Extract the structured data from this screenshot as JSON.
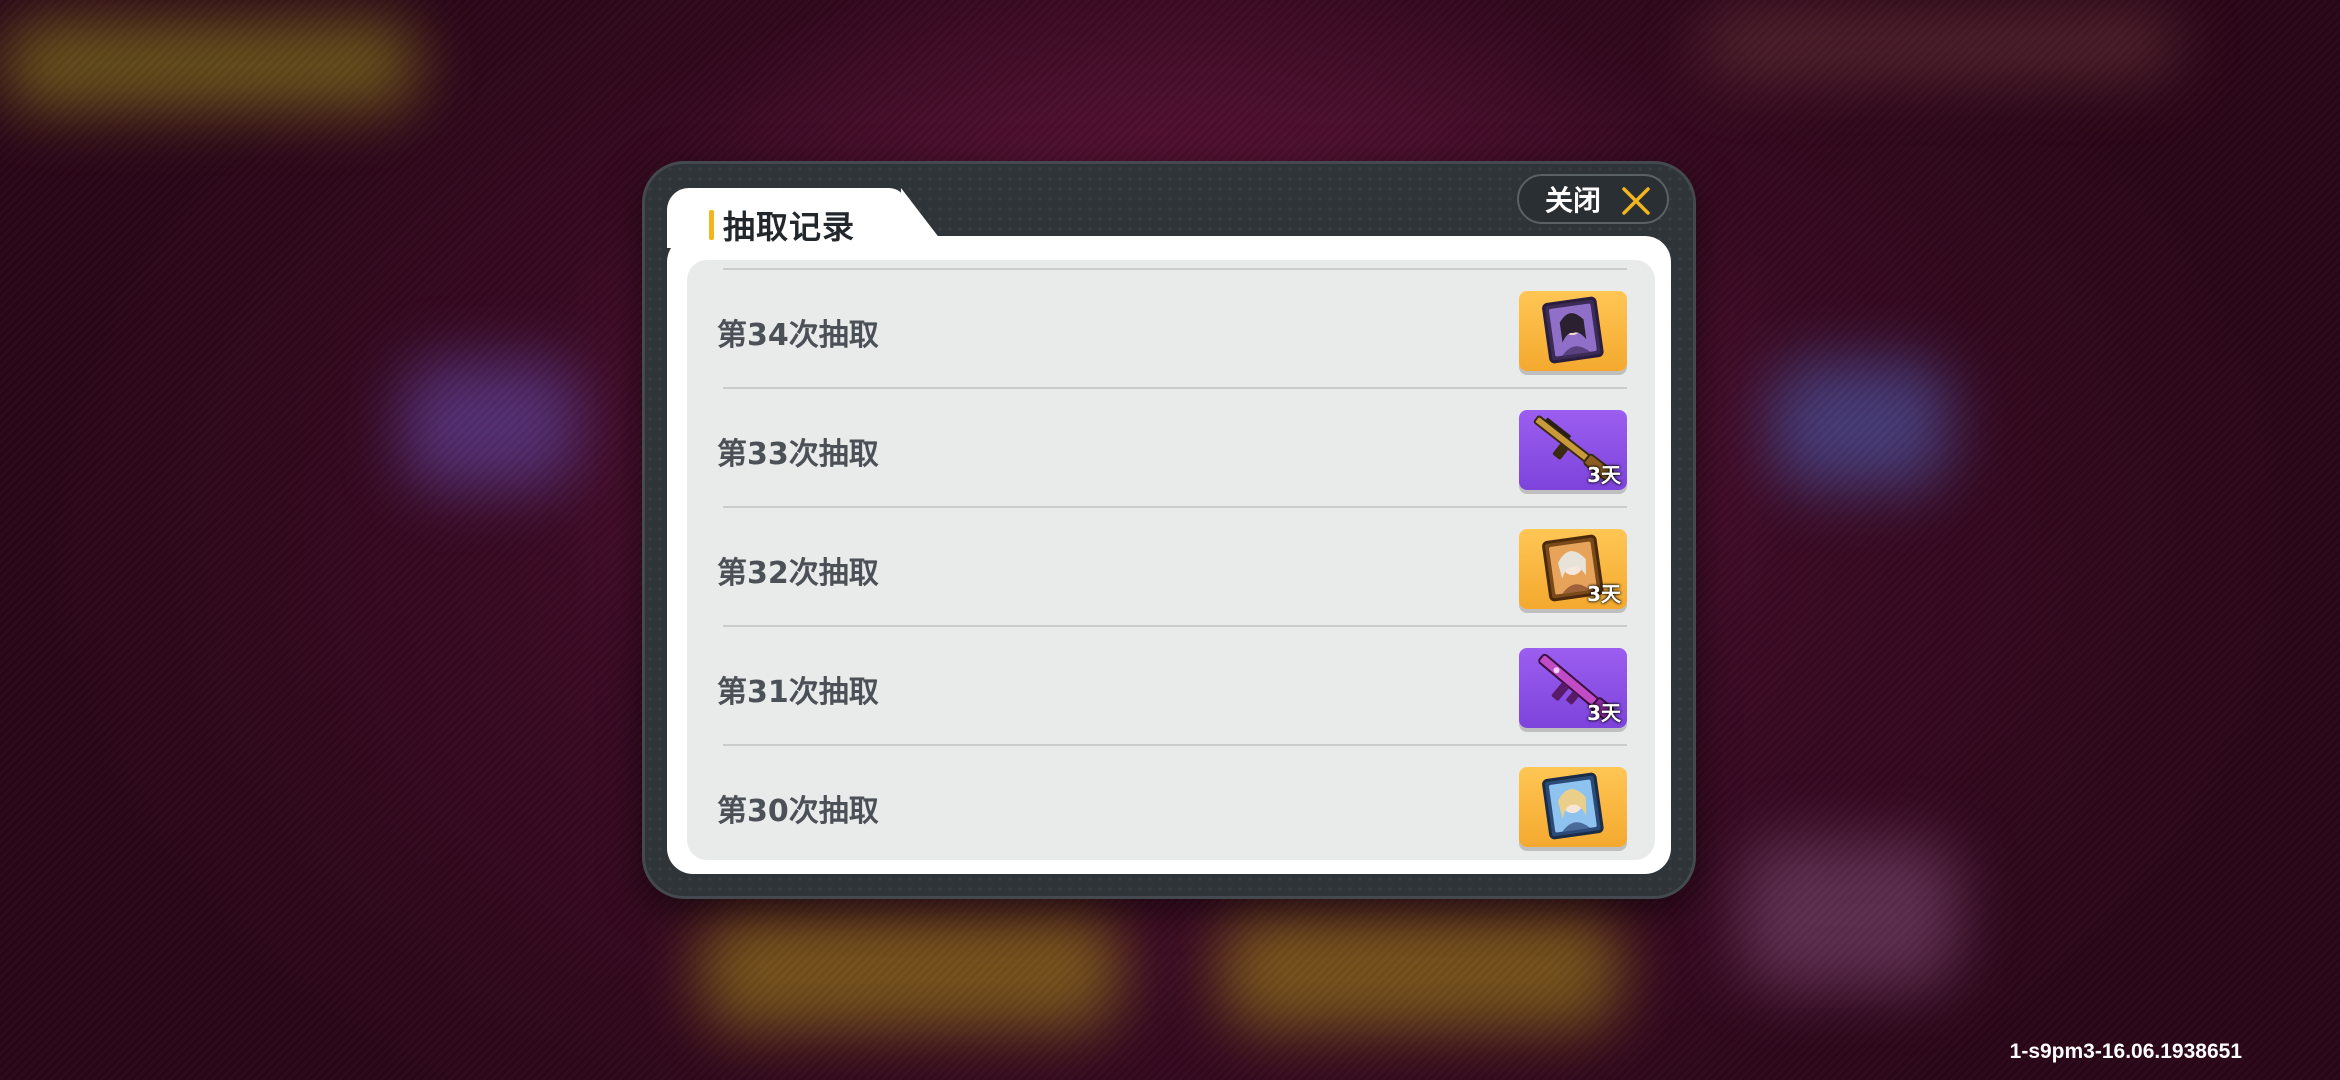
{
  "dialog": {
    "title": "抽取记录",
    "close_label": "关闭"
  },
  "records": [
    {
      "label": "第34次抽取",
      "item_icon": "character-portrait-card-icon",
      "frame": "gold",
      "badge": ""
    },
    {
      "label": "第33次抽取",
      "item_icon": "rifle-weapon-icon",
      "frame": "purple",
      "badge": "3天"
    },
    {
      "label": "第32次抽取",
      "item_icon": "character-portrait-card-icon",
      "frame": "gold",
      "badge": "3天"
    },
    {
      "label": "第31次抽取",
      "item_icon": "assault-rifle-weapon-icon",
      "frame": "purple",
      "badge": "3天"
    },
    {
      "label": "第30次抽取",
      "item_icon": "character-portrait-card-icon",
      "frame": "gold",
      "badge": ""
    }
  ],
  "footer": {
    "build_id": "1-s9pm3-16.06.1938651"
  },
  "colors": {
    "accent": "#f2b51e",
    "gold_frame": "#f4a92e",
    "purple_frame": "#7d43db",
    "panel": "#ffffff",
    "list_bg": "#e9eaea",
    "dialog_bg": "#2f3438"
  }
}
